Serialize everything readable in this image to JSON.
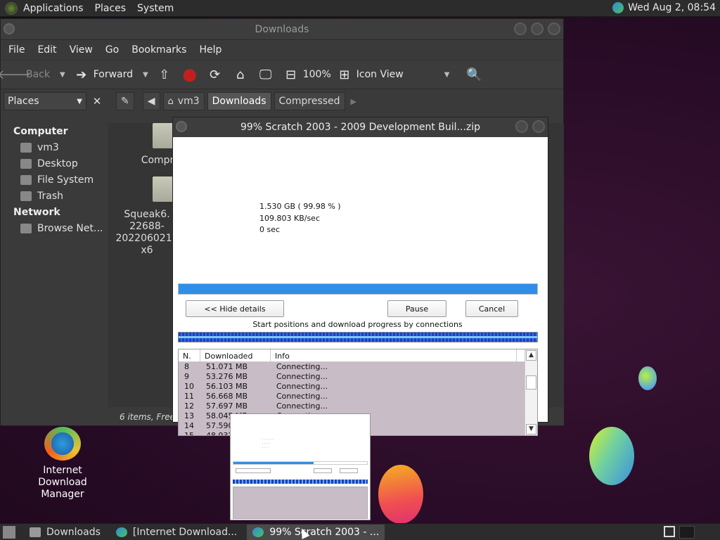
{
  "top_panel": {
    "menus": [
      "Applications",
      "Places",
      "System"
    ],
    "clock": "Wed Aug  2, 08:54"
  },
  "file_manager": {
    "title": "Downloads",
    "menubar": [
      "File",
      "Edit",
      "View",
      "Go",
      "Bookmarks",
      "Help"
    ],
    "toolbar": {
      "back": "Back",
      "forward": "Forward",
      "zoom": "100%",
      "view_mode": "Icon View"
    },
    "places_select": "Places",
    "breadcrumbs": [
      "vm3",
      "Downloads",
      "Compressed"
    ],
    "sidebar": {
      "computer_heading": "Computer",
      "computer_items": [
        "vm3",
        "Desktop",
        "File System",
        "Trash"
      ],
      "network_heading": "Network",
      "network_items": [
        "Browse Net..."
      ]
    },
    "files": [
      {
        "label": "Compr"
      },
      {
        "label": "Squeak6.\n22688-\n2022060214\nx6"
      }
    ],
    "status": "6 items, Free sp"
  },
  "download_dialog": {
    "title": "99% Scratch 2003 - 2009 Development Buil...zip",
    "size": "1.530  GB  ( 99.98 % )",
    "speed": "109.803  KB/sec",
    "time_left": "0 sec",
    "progress": 0.9998,
    "hide_details": "<< Hide details",
    "pause": "Pause",
    "cancel": "Cancel",
    "connections_label": "Start positions and download progress by connections",
    "columns": [
      "N.",
      "Downloaded",
      "Info"
    ],
    "rows": [
      {
        "n": "8",
        "downloaded": "51.071  MB",
        "info": "Connecting..."
      },
      {
        "n": "9",
        "downloaded": "53.276  MB",
        "info": "Connecting..."
      },
      {
        "n": "10",
        "downloaded": "56.103  MB",
        "info": "Connecting..."
      },
      {
        "n": "11",
        "downloaded": "56.668  MB",
        "info": "Connecting..."
      },
      {
        "n": "12",
        "downloaded": "57.697  MB",
        "info": "Connecting..."
      },
      {
        "n": "13",
        "downloaded": "58.045  MB",
        "info": "Connecting..."
      },
      {
        "n": "14",
        "downloaded": "57.590  MB",
        "info": "Connecting..."
      },
      {
        "n": "15",
        "downloaded": "48.932",
        "info": ""
      }
    ]
  },
  "desktop_icon": {
    "label": "Internet Download Manager"
  },
  "taskbar": {
    "tasks": [
      "Downloads",
      "[Internet Download...",
      "99% Scratch 2003 - ..."
    ]
  }
}
